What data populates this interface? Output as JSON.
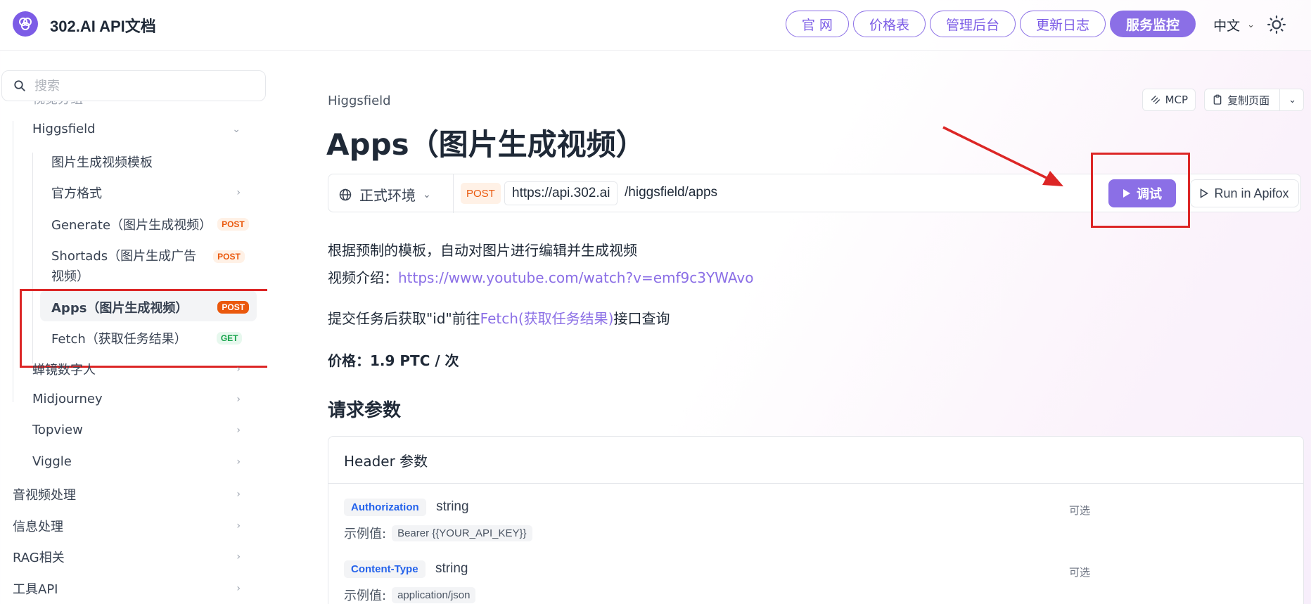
{
  "header": {
    "brand": "302.AI API文档",
    "nav": [
      "官 网",
      "价格表",
      "管理后台",
      "更新日志"
    ],
    "nav_primary": "服务监控",
    "lang": "中文",
    "accent": "#8b6fe6"
  },
  "sidebar": {
    "search_placeholder": "搜索",
    "partial_item": "视觉分组",
    "group": "Higgsfield",
    "children": [
      {
        "label": "图片生成视频模板"
      },
      {
        "label": "官方格式"
      },
      {
        "label": "Generate（图片生成视频）",
        "badge": "POST"
      },
      {
        "label_line1": "Shortads（图片生成广告",
        "label_line2": "视频）",
        "badge": "POST"
      },
      {
        "label": "Apps（图片生成视频）",
        "badge": "POST"
      },
      {
        "label": "Fetch（获取任务结果）",
        "badge": "GET"
      }
    ],
    "siblings": [
      "蝉镜数字人",
      "Midjourney",
      "Topview",
      "Viggle"
    ],
    "top_level": [
      "音视频处理",
      "信息处理",
      "RAG相关",
      "工具API"
    ]
  },
  "main": {
    "breadcrumb": "Higgsfield",
    "title": "Apps（图片生成视频）",
    "actions": {
      "mcp": "MCP",
      "copy": "复制页面"
    },
    "endpoint": {
      "env": "正式环境",
      "method": "POST",
      "base_url": "https://api.302.ai",
      "path": "/higgsfield/apps",
      "try": "调试",
      "apifox": "Run in Apifox"
    },
    "desc1": "根据预制的模板，自动对图片进行编辑并生成视频",
    "desc2_prefix": "视频介绍：",
    "desc2_link": "https://www.youtube.com/watch?v=emf9c3YWAvo",
    "desc3_prefix": "提交任务后获取\"id\"前往",
    "desc3_link": "Fetch(获取任务结果)",
    "desc3_suffix": "接口查询",
    "price": "价格：1.9 PTC / 次",
    "section": "请求参数",
    "params_header": "Header 参数",
    "params": [
      {
        "name": "Authorization",
        "type": "string",
        "optional": "可选",
        "example_label": "示例值:",
        "example": "Bearer {{YOUR_API_KEY}}"
      },
      {
        "name": "Content-Type",
        "type": "string",
        "optional": "可选",
        "example_label": "示例值:",
        "example": "application/json"
      }
    ]
  }
}
